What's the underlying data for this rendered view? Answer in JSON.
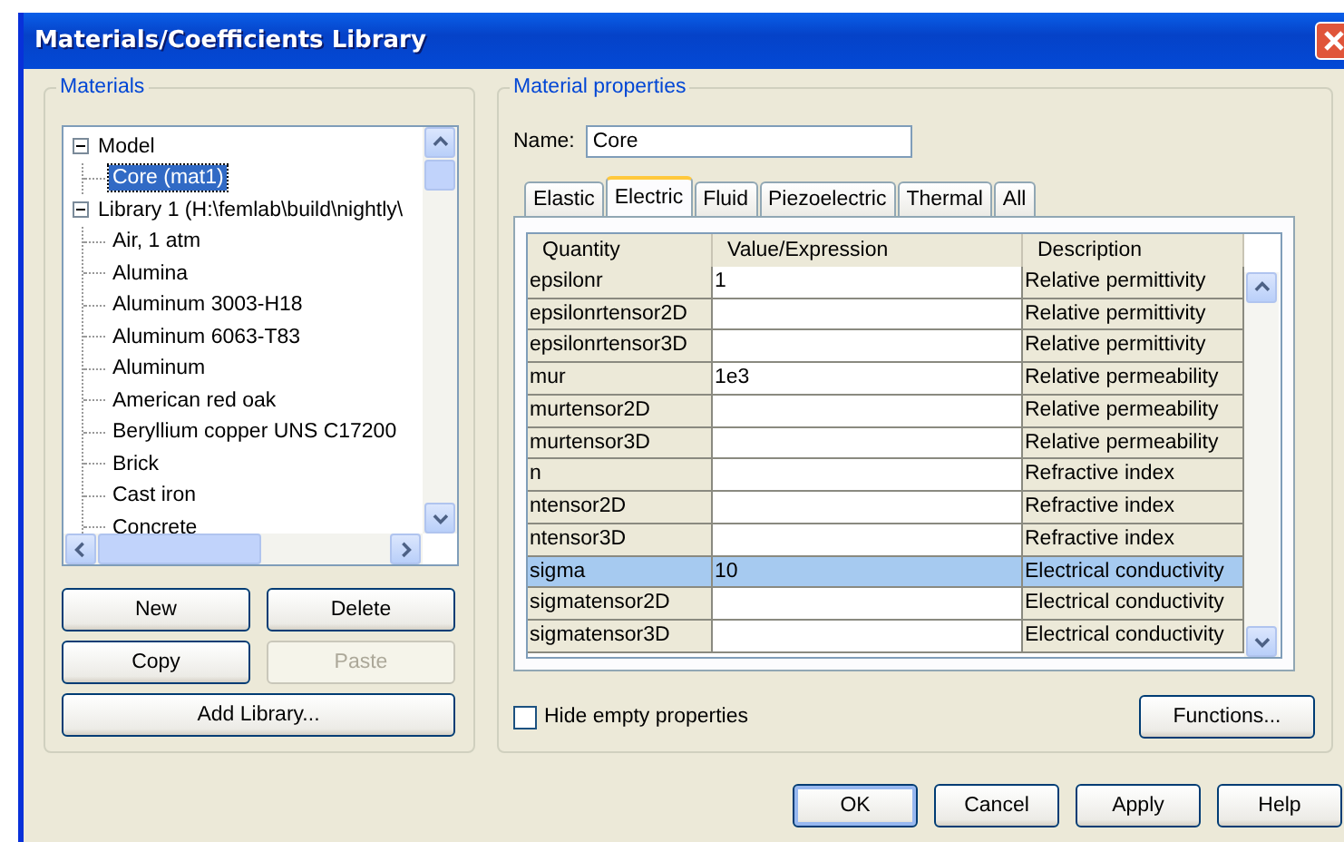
{
  "window": {
    "title": "Materials/Coefficients Library"
  },
  "materials": {
    "title": "Materials",
    "tree": [
      {
        "label": "Model",
        "expanded": true,
        "selected": false,
        "children": [
          {
            "label": "Core (mat1)",
            "selected": true
          }
        ]
      },
      {
        "label": "Library 1 (H:\\femlab\\build\\nightly\\",
        "expanded": true,
        "selected": false,
        "children": [
          {
            "label": "Air, 1 atm",
            "selected": false
          },
          {
            "label": "Alumina",
            "selected": false
          },
          {
            "label": "Aluminum 3003-H18",
            "selected": false
          },
          {
            "label": "Aluminum 6063-T83",
            "selected": false
          },
          {
            "label": "Aluminum",
            "selected": false
          },
          {
            "label": "American red oak",
            "selected": false
          },
          {
            "label": "Beryllium copper UNS C17200",
            "selected": false
          },
          {
            "label": "Brick",
            "selected": false
          },
          {
            "label": "Cast iron",
            "selected": false
          },
          {
            "label": "Concrete",
            "selected": false
          }
        ]
      }
    ],
    "buttons": [
      {
        "label": "New",
        "disabled": false
      },
      {
        "label": "Delete",
        "disabled": false
      },
      {
        "label": "Copy",
        "disabled": false
      },
      {
        "label": "Paste",
        "disabled": true
      }
    ],
    "add_library_button": "Add Library..."
  },
  "properties": {
    "title": "Material properties",
    "name_label": "Name:",
    "name_value": "Core",
    "tabs": [
      {
        "label": "Elastic",
        "selected": false
      },
      {
        "label": "Electric",
        "selected": true
      },
      {
        "label": "Fluid",
        "selected": false
      },
      {
        "label": "Piezoelectric",
        "selected": false
      },
      {
        "label": "Thermal",
        "selected": false
      },
      {
        "label": "All",
        "selected": false
      }
    ],
    "table": {
      "columns": [
        "Quantity",
        "Value/Expression",
        "Description"
      ],
      "rows": [
        {
          "quantity": "epsilonr",
          "value": "1",
          "description": "Relative permittivity",
          "selected": false
        },
        {
          "quantity": "epsilonrtensor2D",
          "description": "Relative permittivity",
          "selected": false
        },
        {
          "quantity": "epsilonrtensor3D",
          "description": "Relative permittivity",
          "selected": false
        },
        {
          "quantity": "mur",
          "value": "1e3",
          "description": "Relative permeability",
          "selected": false
        },
        {
          "quantity": "murtensor2D",
          "description": "Relative permeability",
          "selected": false
        },
        {
          "quantity": "murtensor3D",
          "description": "Relative permeability",
          "selected": false
        },
        {
          "quantity": "n",
          "description": "Refractive index",
          "selected": false
        },
        {
          "quantity": "ntensor2D",
          "description": "Refractive index",
          "selected": false
        },
        {
          "quantity": "ntensor3D",
          "description": "Refractive index",
          "selected": false
        },
        {
          "quantity": "sigma",
          "value": "10",
          "description": "Electrical conductivity",
          "selected": true
        },
        {
          "quantity": "sigmatensor2D",
          "description": "Electrical conductivity",
          "selected": false
        },
        {
          "quantity": "sigmatensor3D",
          "description": "Electrical conductivity",
          "selected": false
        }
      ]
    },
    "hide_empty": {
      "label": "Hide empty properties",
      "checked": false
    },
    "functions_button": "Functions..."
  },
  "dialog_buttons": [
    {
      "label": "OK",
      "default": true
    },
    {
      "label": "Cancel",
      "default": false
    },
    {
      "label": "Apply",
      "default": false
    },
    {
      "label": "Help",
      "default": false
    }
  ]
}
